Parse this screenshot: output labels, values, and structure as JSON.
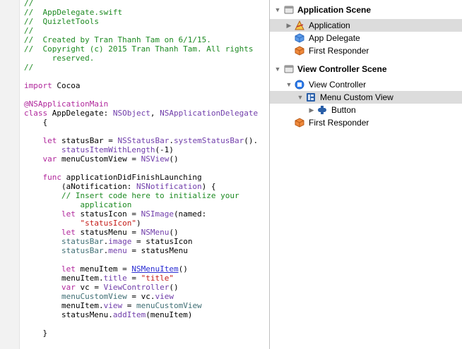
{
  "code_lines": [
    [
      {
        "t": "//",
        "c": "c"
      }
    ],
    [
      {
        "t": "//  AppDelegate.swift",
        "c": "c"
      }
    ],
    [
      {
        "t": "//  QuizletTools",
        "c": "c"
      }
    ],
    [
      {
        "t": "//",
        "c": "c"
      }
    ],
    [
      {
        "t": "//  Created by Tran Thanh Tam on 6/1/15.",
        "c": "c"
      }
    ],
    [
      {
        "t": "//  Copyright (c) 2015 Tran Thanh Tam. All rights",
        "c": "c"
      }
    ],
    [
      {
        "t": "      reserved.",
        "c": "c"
      }
    ],
    [
      {
        "t": "//",
        "c": "c"
      }
    ],
    [],
    [
      {
        "t": "import",
        "c": "k"
      },
      {
        "t": " Cocoa"
      }
    ],
    [],
    [
      {
        "t": "@NSApplicationMain",
        "c": "k"
      }
    ],
    [
      {
        "t": "class",
        "c": "k"
      },
      {
        "t": " AppDelegate: "
      },
      {
        "t": "NSObject",
        "c": "t"
      },
      {
        "t": ", "
      },
      {
        "t": "NSApplicationDelegate",
        "c": "t"
      }
    ],
    [
      {
        "t": "    {"
      }
    ],
    [],
    [
      {
        "t": "    "
      },
      {
        "t": "let",
        "c": "k"
      },
      {
        "t": " statusBar = "
      },
      {
        "t": "NSStatusBar",
        "c": "t"
      },
      {
        "t": "."
      },
      {
        "t": "systemStatusBar",
        "c": "t"
      },
      {
        "t": "()."
      }
    ],
    [
      {
        "t": "        "
      },
      {
        "t": "statusItemWithLength",
        "c": "t"
      },
      {
        "t": "(-1)"
      }
    ],
    [
      {
        "t": "    "
      },
      {
        "t": "var",
        "c": "k"
      },
      {
        "t": " menuCustomView = "
      },
      {
        "t": "NSView",
        "c": "t"
      },
      {
        "t": "()"
      }
    ],
    [],
    [
      {
        "t": "    "
      },
      {
        "t": "func",
        "c": "k"
      },
      {
        "t": " applicationDidFinishLaunching"
      }
    ],
    [
      {
        "t": "        (aNotification: "
      },
      {
        "t": "NSNotification",
        "c": "t"
      },
      {
        "t": ") {"
      }
    ],
    [
      {
        "t": "        "
      },
      {
        "t": "// Insert code here to initialize your",
        "c": "c"
      }
    ],
    [
      {
        "t": "            application",
        "c": "c"
      }
    ],
    [
      {
        "t": "        "
      },
      {
        "t": "let",
        "c": "k"
      },
      {
        "t": " statusIcon = "
      },
      {
        "t": "NSImage",
        "c": "t"
      },
      {
        "t": "(named:"
      }
    ],
    [
      {
        "t": "            "
      },
      {
        "t": "\"statusIcon\"",
        "c": "s"
      },
      {
        "t": ")"
      }
    ],
    [
      {
        "t": "        "
      },
      {
        "t": "let",
        "c": "k"
      },
      {
        "t": " statusMenu = "
      },
      {
        "t": "NSMenu",
        "c": "t"
      },
      {
        "t": "()"
      }
    ],
    [
      {
        "t": "        "
      },
      {
        "t": "statusBar",
        "c": "m"
      },
      {
        "t": "."
      },
      {
        "t": "image",
        "c": "t"
      },
      {
        "t": " = statusIcon"
      }
    ],
    [
      {
        "t": "        "
      },
      {
        "t": "statusBar",
        "c": "m"
      },
      {
        "t": "."
      },
      {
        "t": "menu",
        "c": "t"
      },
      {
        "t": " = statusMenu"
      }
    ],
    [],
    [
      {
        "t": "        "
      },
      {
        "t": "let",
        "c": "k"
      },
      {
        "t": " menuItem = "
      },
      {
        "t": "NSMenuItem",
        "c": "u"
      },
      {
        "t": "()"
      }
    ],
    [
      {
        "t": "        menuItem."
      },
      {
        "t": "title",
        "c": "t"
      },
      {
        "t": " = "
      },
      {
        "t": "\"title\"",
        "c": "s"
      }
    ],
    [
      {
        "t": "        "
      },
      {
        "t": "var",
        "c": "k"
      },
      {
        "t": " vc = "
      },
      {
        "t": "ViewController",
        "c": "t"
      },
      {
        "t": "()"
      }
    ],
    [
      {
        "t": "        "
      },
      {
        "t": "menuCustomView",
        "c": "m"
      },
      {
        "t": " = vc."
      },
      {
        "t": "view",
        "c": "t"
      }
    ],
    [
      {
        "t": "        menuItem."
      },
      {
        "t": "view",
        "c": "t"
      },
      {
        "t": " = "
      },
      {
        "t": "menuCustomView",
        "c": "m"
      }
    ],
    [
      {
        "t": "        statusMenu."
      },
      {
        "t": "addItem",
        "c": "t"
      },
      {
        "t": "(menuItem)"
      }
    ],
    [],
    [
      {
        "t": "    }"
      }
    ]
  ],
  "outline": {
    "app_scene": "Application Scene",
    "application": "Application",
    "app_delegate": "App Delegate",
    "first_responder_1": "First Responder",
    "vc_scene": "View Controller Scene",
    "view_controller": "View Controller",
    "menu_custom_view": "Menu Custom View",
    "button": "Button",
    "first_responder_2": "First Responder"
  },
  "colors": {
    "comment": "#1d8a22",
    "keyword": "#b0269b",
    "type": "#703daa",
    "member": "#3f6e74",
    "string": "#c41a16",
    "link": "#2a2dd3",
    "selection": "#dcdcdc"
  }
}
